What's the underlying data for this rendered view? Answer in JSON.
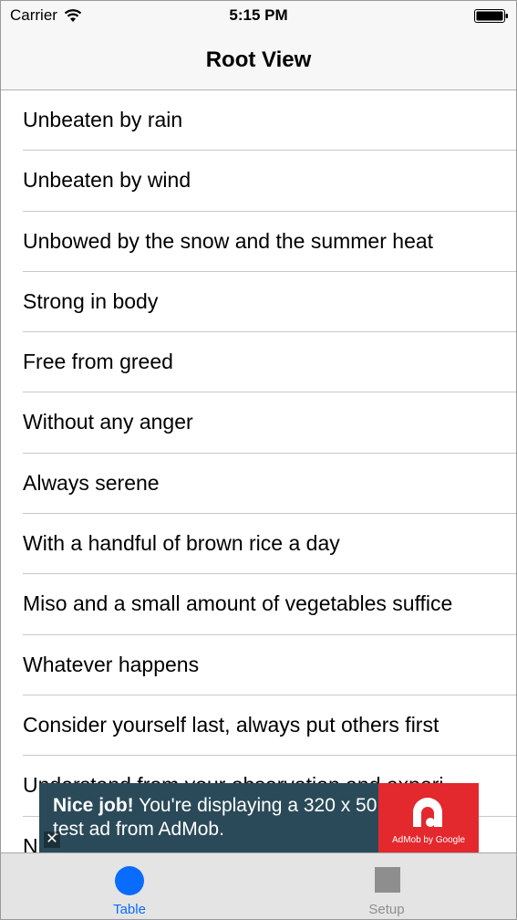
{
  "status_bar": {
    "carrier": "Carrier",
    "time": "5:15 PM"
  },
  "nav": {
    "title": "Root View"
  },
  "table": {
    "rows": [
      "Unbeaten by rain",
      "Unbeaten by wind",
      "Unbowed by the snow and the summer heat",
      "Strong in body",
      "Free from greed",
      "Without any anger",
      "Always serene",
      "With a handful of brown rice a day",
      "Miso and a small amount of vegetables suffice",
      "Whatever happens",
      "Consider yourself last, always put others first",
      "Understand from your observation and experi...",
      "N"
    ]
  },
  "ad": {
    "headline": "Nice job!",
    "body": " You're displaying a 320 x 50 test ad from AdMob.",
    "brand": "AdMob by Google",
    "close_glyph": "✕",
    "colors": {
      "background": "#2b4a59",
      "logo_background": "#e3282e"
    }
  },
  "tab_bar": {
    "tabs": [
      {
        "label": "Table",
        "icon": "circle-icon",
        "selected": true
      },
      {
        "label": "Setup",
        "icon": "square-icon",
        "selected": false
      }
    ],
    "colors": {
      "selected": "#0a6cff",
      "unselected": "#8e8e8e"
    }
  }
}
